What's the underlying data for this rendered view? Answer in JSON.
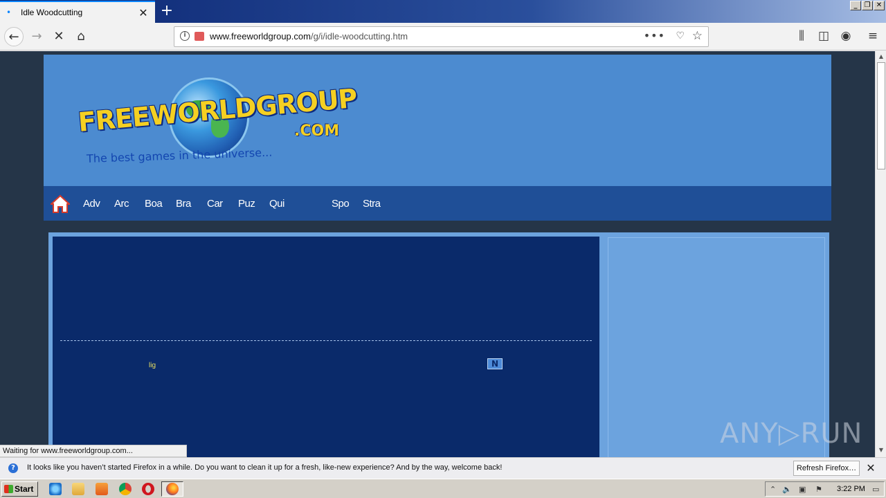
{
  "browser": {
    "tab_title": "Idle Woodcutting",
    "new_tab": "+",
    "url_domain": "www.freeworldgroup.com",
    "url_path": "/g/i/idle-woodcutting.htm",
    "status_text": "Waiting for www.freeworldgroup.com..."
  },
  "site": {
    "logo_text": "FREEWORLDGROUP",
    "logo_com": ".COM",
    "tagline": "The best games in the universe...",
    "nav": [
      "Adv",
      "Arc",
      "Boa",
      "Bra",
      "Car",
      "Puz",
      "Qui",
      "Spo",
      "Stra"
    ],
    "loading_text": "lig",
    "n_logo": "N"
  },
  "notification": {
    "message": "It looks like you haven’t started Firefox in a while. Do you want to clean it up for a fresh, like-new experience? And by the way, welcome back!",
    "button": "Refresh Firefox…"
  },
  "taskbar": {
    "start": "Start",
    "clock": "3:22 PM"
  },
  "watermark": "ANY▷RUN",
  "colors": {
    "header_bg": "#4c8bd0",
    "nav_bg": "#1f4f97",
    "game_bg": "#0a2a6a",
    "page_bg": "#253548"
  }
}
